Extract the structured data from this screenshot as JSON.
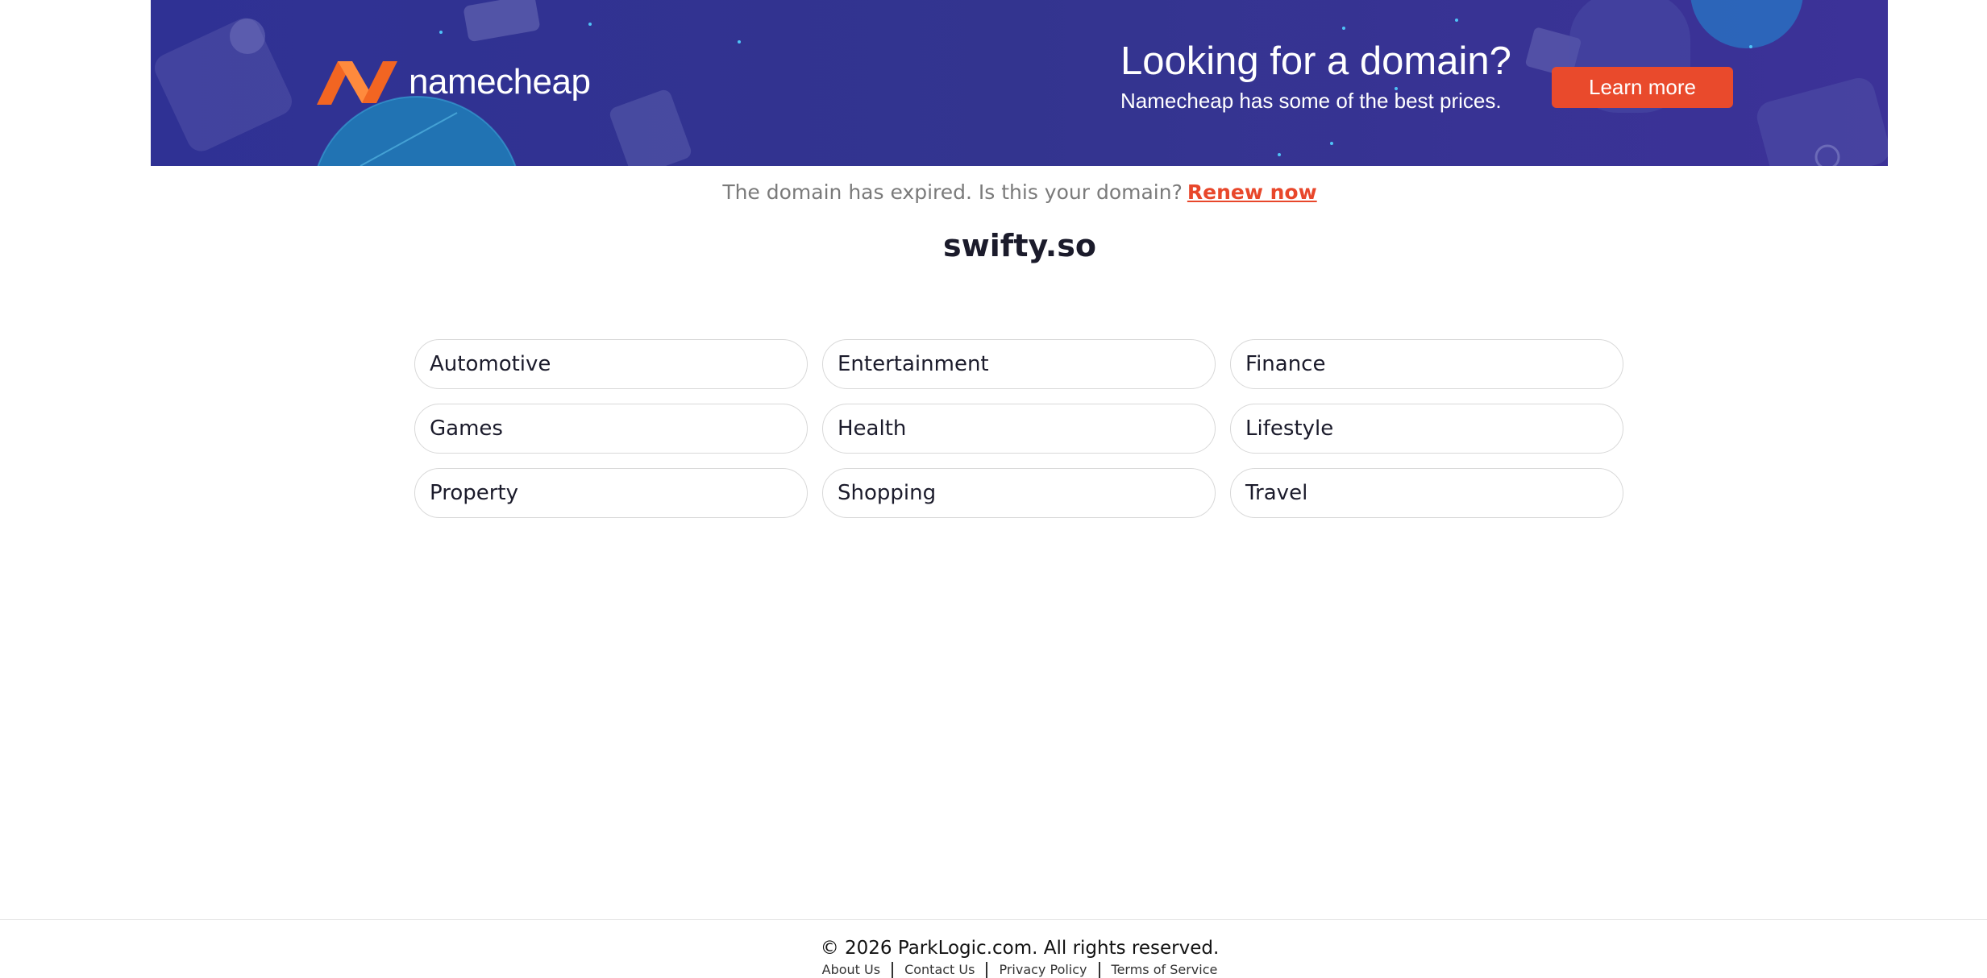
{
  "banner": {
    "logo_text": "namecheap",
    "promo_title": "Looking for a domain?",
    "promo_subtitle": "Namecheap has some of the best prices.",
    "button_label": "Learn more",
    "colors": {
      "background": "#33348f",
      "accent": "#e94a2c",
      "logo_orange": "#f26522"
    }
  },
  "notice": {
    "text": "The domain has expired. Is this your domain?",
    "link_label": "Renew now"
  },
  "domain": "swifty.so",
  "categories": [
    "Automotive",
    "Entertainment",
    "Finance",
    "Games",
    "Health",
    "Lifestyle",
    "Property",
    "Shopping",
    "Travel"
  ],
  "footer": {
    "copyright": "© 2026 ParkLogic.com. All rights reserved.",
    "links": [
      "About Us",
      "Contact Us",
      "Privacy Policy",
      "Terms of Service"
    ]
  }
}
